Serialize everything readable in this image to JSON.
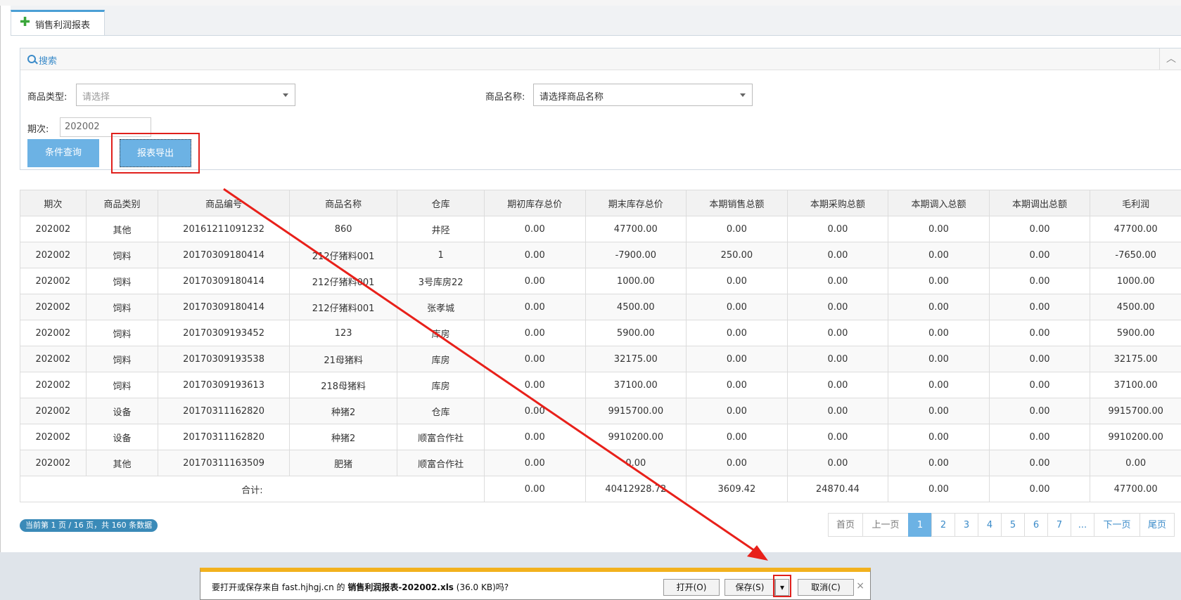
{
  "tab": {
    "label": "销售利润报表",
    "icon": "plus-icon"
  },
  "search": {
    "title": "搜索",
    "category_label": "商品类型:",
    "category_placeholder": "请选择",
    "name_label": "商品名称:",
    "name_placeholder": "请选择商品名称",
    "period_label": "期次:",
    "period_value": "202002",
    "query_button": "条件查询",
    "export_button": "报表导出"
  },
  "table": {
    "columns": [
      "期次",
      "商品类别",
      "商品编号",
      "商品名称",
      "仓库",
      "期初库存总价",
      "期末库存总价",
      "本期销售总额",
      "本期采购总额",
      "本期调入总额",
      "本期调出总额",
      "毛利润"
    ],
    "rows": [
      [
        "202002",
        "其他",
        "20161211091232",
        "860",
        "井陉",
        "0.00",
        "47700.00",
        "0.00",
        "0.00",
        "0.00",
        "0.00",
        "47700.00"
      ],
      [
        "202002",
        "饲料",
        "20170309180414",
        "212仔猪料001",
        "1",
        "0.00",
        "-7900.00",
        "250.00",
        "0.00",
        "0.00",
        "0.00",
        "-7650.00"
      ],
      [
        "202002",
        "饲料",
        "20170309180414",
        "212仔猪料001",
        "3号库房22",
        "0.00",
        "1000.00",
        "0.00",
        "0.00",
        "0.00",
        "0.00",
        "1000.00"
      ],
      [
        "202002",
        "饲料",
        "20170309180414",
        "212仔猪料001",
        "张孝城",
        "0.00",
        "4500.00",
        "0.00",
        "0.00",
        "0.00",
        "0.00",
        "4500.00"
      ],
      [
        "202002",
        "饲料",
        "20170309193452",
        "123",
        "库房",
        "0.00",
        "5900.00",
        "0.00",
        "0.00",
        "0.00",
        "0.00",
        "5900.00"
      ],
      [
        "202002",
        "饲料",
        "20170309193538",
        "21母猪料",
        "库房",
        "0.00",
        "32175.00",
        "0.00",
        "0.00",
        "0.00",
        "0.00",
        "32175.00"
      ],
      [
        "202002",
        "饲料",
        "20170309193613",
        "218母猪料",
        "库房",
        "0.00",
        "37100.00",
        "0.00",
        "0.00",
        "0.00",
        "0.00",
        "37100.00"
      ],
      [
        "202002",
        "设备",
        "20170311162820",
        "种猪2",
        "仓库",
        "0.00",
        "9915700.00",
        "0.00",
        "0.00",
        "0.00",
        "0.00",
        "9915700.00"
      ],
      [
        "202002",
        "设备",
        "20170311162820",
        "种猪2",
        "顺富合作社",
        "0.00",
        "9910200.00",
        "0.00",
        "0.00",
        "0.00",
        "0.00",
        "9910200.00"
      ],
      [
        "202002",
        "其他",
        "20170311163509",
        "肥猪",
        "顺富合作社",
        "0.00",
        "0.00",
        "0.00",
        "0.00",
        "0.00",
        "0.00",
        "0.00"
      ]
    ],
    "total_label": "合计:",
    "totals": [
      "0.00",
      "40412928.72",
      "3609.42",
      "24870.44",
      "0.00",
      "0.00",
      "47700.00"
    ]
  },
  "pagination": {
    "info": "当前第 1 页 / 16 页，共 160 条数据",
    "first": "首页",
    "prev": "上一页",
    "pages": [
      "1",
      "2",
      "3",
      "4",
      "5",
      "6",
      "7",
      "..."
    ],
    "next": "下一页",
    "last": "尾页"
  },
  "download": {
    "prefix": "要打开或保存来自 fast.hjhgj.cn 的 ",
    "filename": "销售利润报表-202002.xls",
    "size": " (36.0 KB)",
    "suffix": "吗?",
    "open": "打开(O)",
    "save": "保存(S)",
    "cancel": "取消(C)",
    "close": "×"
  },
  "colors": {
    "accent": "#6cb2e4",
    "highlight": "#e0201c",
    "banner": "#f2b11e"
  }
}
